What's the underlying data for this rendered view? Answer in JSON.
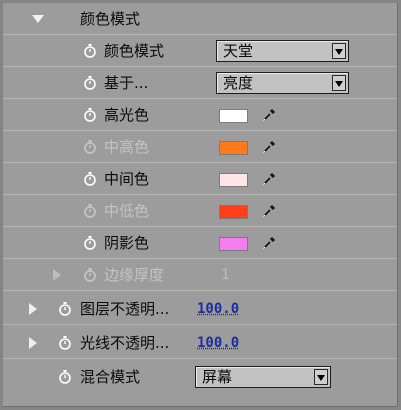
{
  "group": {
    "label": "颜色模式"
  },
  "rows": [
    {
      "label": "颜色模式",
      "type": "select",
      "value": "天堂"
    },
    {
      "label": "基于...",
      "type": "select",
      "value": "亮度"
    },
    {
      "label": "高光色",
      "type": "color",
      "color": "#ffffff"
    },
    {
      "label": "中高色",
      "type": "color",
      "color": "#ff7a1a",
      "disabled": true
    },
    {
      "label": "中间色",
      "type": "color",
      "color": "#ffe6e6"
    },
    {
      "label": "中低色",
      "type": "color",
      "color": "#ff3f1a",
      "disabled": true
    },
    {
      "label": "阴影色",
      "type": "color",
      "color": "#f57df0"
    },
    {
      "label": "边缘厚度",
      "type": "number",
      "value": "1",
      "disabled": true
    }
  ],
  "layer_opacity": {
    "label": "图层不透明...",
    "value": "100.0"
  },
  "light_opacity": {
    "label": "光线不透明...",
    "value": "100.0"
  },
  "blend_mode": {
    "label": "混合模式",
    "value": "屏幕"
  }
}
